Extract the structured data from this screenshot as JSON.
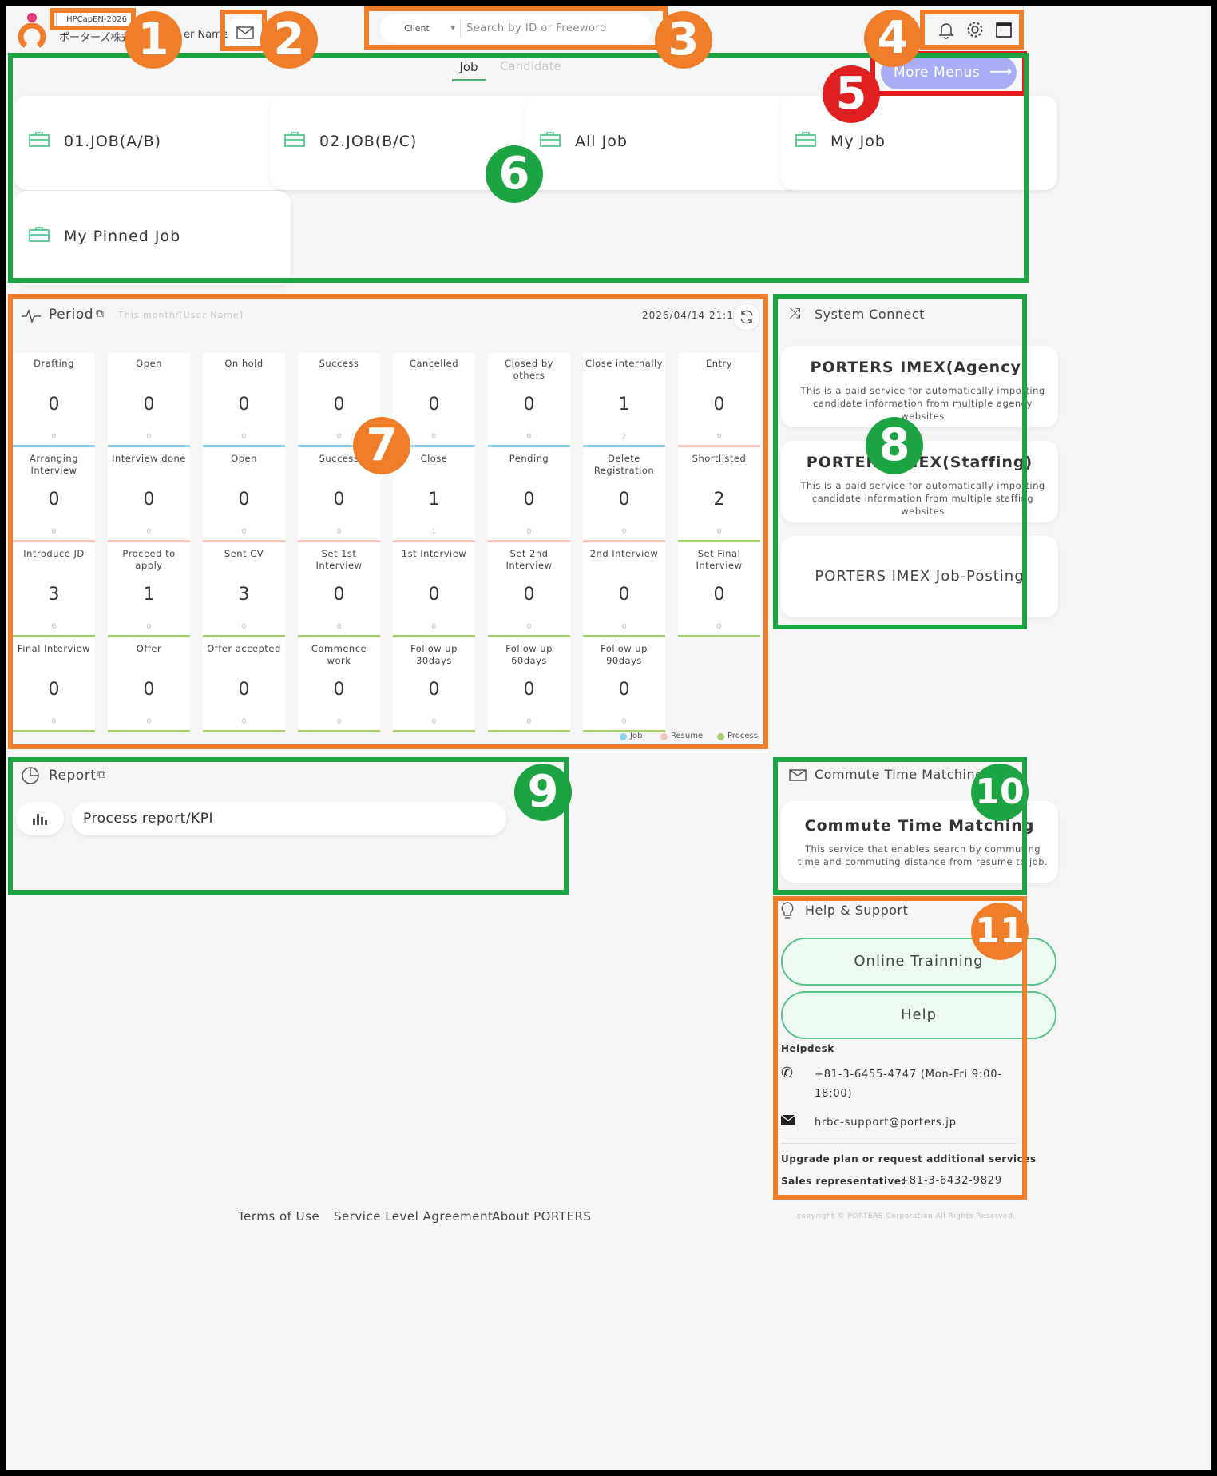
{
  "header": {
    "tenant_badge": "HPCapEN-2026",
    "company_name": "ポーターズ株式",
    "user_name": "er Name",
    "search": {
      "scope": "Client",
      "placeholder": "Search by ID or Freeword"
    }
  },
  "tabs": [
    {
      "label": "Job"
    },
    {
      "label": "Candidate"
    }
  ],
  "more_menus_label": "More Menus",
  "menu_cards": [
    {
      "label": "01.JOB(A/B)"
    },
    {
      "label": "02.JOB(B/C)"
    },
    {
      "label": "All Job"
    },
    {
      "label": "My Job"
    },
    {
      "label": "My Pinned Job"
    }
  ],
  "period": {
    "title": "Period",
    "subtitle": "This month/[User Name]",
    "timestamp": "2026/04/14 21:16",
    "tiles": [
      {
        "title": "Drafting",
        "value": "0",
        "sub": "0",
        "kind": "job"
      },
      {
        "title": "Open",
        "value": "0",
        "sub": "0",
        "kind": "job"
      },
      {
        "title": "On hold",
        "value": "0",
        "sub": "0",
        "kind": "job"
      },
      {
        "title": "Success",
        "value": "0",
        "sub": "0",
        "kind": "job"
      },
      {
        "title": "Cancelled",
        "value": "0",
        "sub": "0",
        "kind": "job"
      },
      {
        "title": "Closed by others",
        "value": "0",
        "sub": "0",
        "kind": "job"
      },
      {
        "title": "Close internally",
        "value": "1",
        "sub": "2",
        "kind": "job"
      },
      {
        "title": "Entry",
        "value": "0",
        "sub": "0",
        "kind": "resume"
      },
      {
        "title": "Arranging Interview",
        "value": "0",
        "sub": "0",
        "kind": "resume"
      },
      {
        "title": "Interview done",
        "value": "0",
        "sub": "0",
        "kind": "resume"
      },
      {
        "title": "Open",
        "value": "0",
        "sub": "0",
        "kind": "resume"
      },
      {
        "title": "Success",
        "value": "0",
        "sub": "0",
        "kind": "resume"
      },
      {
        "title": "Close",
        "value": "1",
        "sub": "1",
        "kind": "resume"
      },
      {
        "title": "Pending",
        "value": "0",
        "sub": "0",
        "kind": "resume"
      },
      {
        "title": "Delete Registration",
        "value": "0",
        "sub": "0",
        "kind": "resume"
      },
      {
        "title": "Shortlisted",
        "value": "2",
        "sub": "0",
        "kind": "process"
      },
      {
        "title": "Introduce JD",
        "value": "3",
        "sub": "0",
        "kind": "process"
      },
      {
        "title": "Proceed to apply",
        "value": "1",
        "sub": "0",
        "kind": "process"
      },
      {
        "title": "Sent CV",
        "value": "3",
        "sub": "0",
        "kind": "process"
      },
      {
        "title": "Set 1st Interview",
        "value": "0",
        "sub": "0",
        "kind": "process"
      },
      {
        "title": "1st Interview",
        "value": "0",
        "sub": "0",
        "kind": "process"
      },
      {
        "title": "Set 2nd Interview",
        "value": "0",
        "sub": "0",
        "kind": "process"
      },
      {
        "title": "2nd Interview",
        "value": "0",
        "sub": "0",
        "kind": "process"
      },
      {
        "title": "Set Final Interview",
        "value": "0",
        "sub": "0",
        "kind": "process"
      },
      {
        "title": "Final Interview",
        "value": "0",
        "sub": "0",
        "kind": "process"
      },
      {
        "title": "Offer",
        "value": "0",
        "sub": "0",
        "kind": "process"
      },
      {
        "title": "Offer accepted",
        "value": "0",
        "sub": "0",
        "kind": "process"
      },
      {
        "title": "Commence work",
        "value": "0",
        "sub": "0",
        "kind": "process"
      },
      {
        "title": "Follow up 30days",
        "value": "0",
        "sub": "0",
        "kind": "process"
      },
      {
        "title": "Follow up 60days",
        "value": "0",
        "sub": "0",
        "kind": "process"
      },
      {
        "title": "Follow up 90days",
        "value": "0",
        "sub": "0",
        "kind": "process"
      }
    ],
    "legend": [
      {
        "label": "Job",
        "color": "#8fd3ee"
      },
      {
        "label": "Resume",
        "color": "#f7c5bd"
      },
      {
        "label": "Process",
        "color": "#a8cf6f"
      }
    ]
  },
  "system_connect": {
    "title": "System Connect",
    "cards": [
      {
        "title": "PORTERS IMEX(Agency)",
        "desc": "This is a paid service for automatically importing candidate information from multiple agency websites"
      },
      {
        "title": "PORTERS IMEX(Staffing)",
        "desc": "This is a paid service for automatically importing candidate information from multiple staffing websites"
      },
      {
        "title": "PORTERS IMEX Job-Posting"
      }
    ]
  },
  "report": {
    "title": "Report",
    "item": "Process report/KPI"
  },
  "commute": {
    "title": "Commute Time Matching",
    "card_title": "Commute Time Matching",
    "card_desc": "This service that enables search by commuting time and commuting distance from resume to job."
  },
  "help": {
    "title": "Help & Support",
    "buttons": [
      "Online Trainning",
      "Help"
    ],
    "helpdesk_label": "Helpdesk",
    "phone": "+81-3-6455-4747 (Mon-Fri 9:00-",
    "phone_hours": "18:00)",
    "email": "hrbc-support@porters.jp",
    "upgrade": "Upgrade plan or request additional services",
    "sales_label": "Sales representative:",
    "sales_phone": "+81-3-6432-9829"
  },
  "footer": {
    "links": [
      "Terms of Use",
      "Service Level Agreement",
      "About PORTERS"
    ],
    "copyright": "copyright © PORTERS Corporation All Rights Reserved."
  },
  "annotations": [
    "1",
    "2",
    "3",
    "4",
    "5",
    "6",
    "7",
    "8",
    "9",
    "10",
    "11"
  ],
  "colors": {
    "annotation_orange": "#f07d2a",
    "annotation_green": "#1ea543",
    "annotation_red": "#e02020",
    "more_menus_bg": "#a8adf5",
    "job_icon": "#3fbf7f"
  }
}
